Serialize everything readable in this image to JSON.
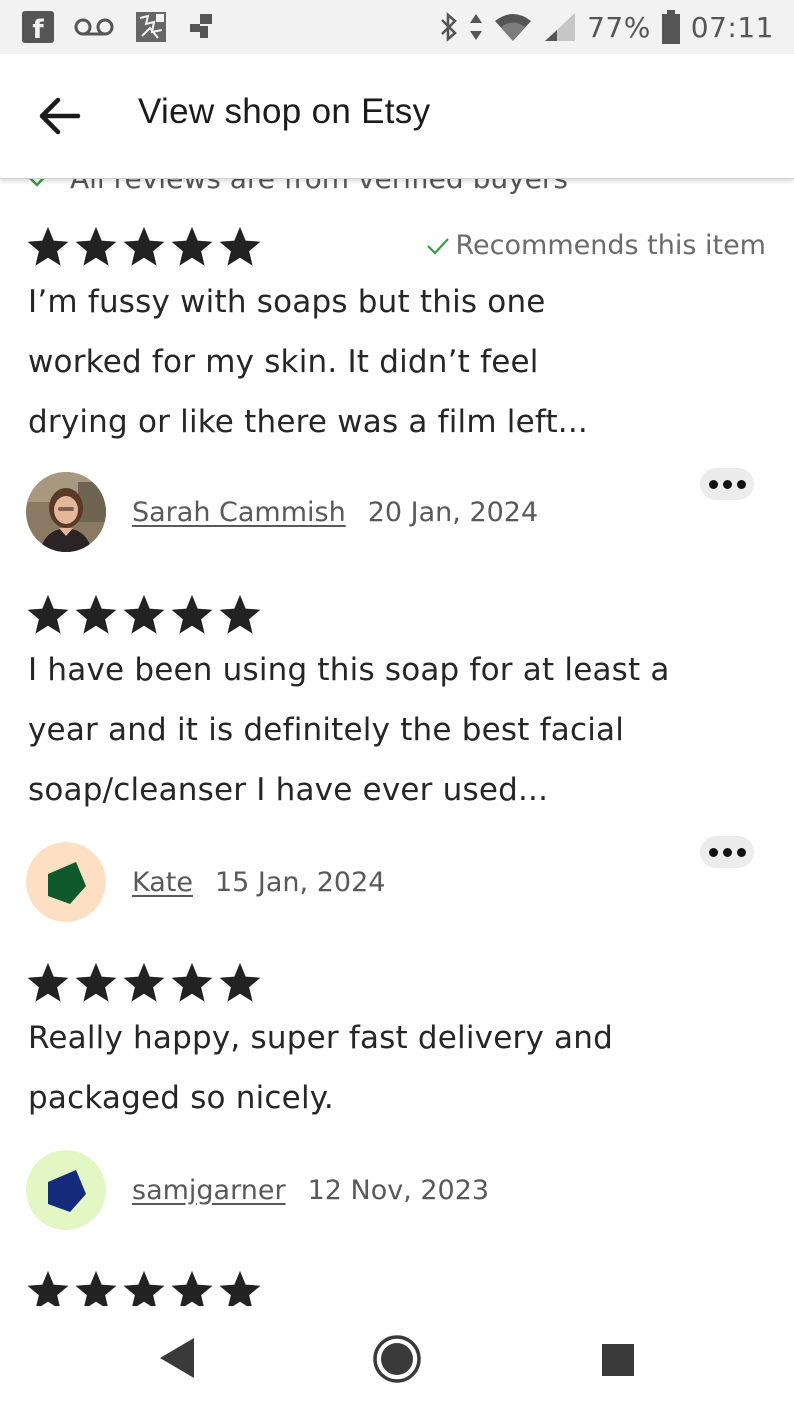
{
  "status_bar": {
    "battery_percent": "77%",
    "time": "07:11",
    "icons_left": [
      "facebook-icon",
      "voicemail-icon",
      "photo-app-icon",
      "app-grid-icon"
    ],
    "icons_right": [
      "bluetooth-icon",
      "data-arrows-icon",
      "wifi-icon",
      "signal-icon",
      "battery-icon"
    ]
  },
  "app_bar": {
    "title": "View shop on Etsy",
    "back_icon": "arrow-left-icon"
  },
  "verified_note": "All reviews are from verified buyers",
  "reviews": [
    {
      "rating": 5,
      "recommends": "Recommends this item",
      "text": "I’m fussy with soaps but this one worked for my skin. It didn’t feel drying or like there was a film left...",
      "reviewer": "Sarah Cammish",
      "date": "20 Jan, 2024",
      "avatar": "photo-avatar"
    },
    {
      "rating": 5,
      "text": "I have been using this soap for at least a year and it is definitely the best facial soap/cleanser I have ever used...",
      "reviewer": "Kate",
      "date": "15 Jan, 2024",
      "avatar": "pentagon-avatar",
      "avatar_bg": "#fde0c3",
      "avatar_fg": "#0e5a2b"
    },
    {
      "rating": 5,
      "text": "Really happy, super fast delivery and packaged so nicely.",
      "reviewer": "samjgarner",
      "date": "12 Nov, 2023",
      "avatar": "pentagon-avatar",
      "avatar_bg": "#e2f7c4",
      "avatar_fg": "#132b7a"
    },
    {
      "rating": 5
    }
  ],
  "colors": {
    "star": "#222222",
    "check_green": "#3a9a4a"
  },
  "nav_bar": {
    "icons": [
      "back-triangle-icon",
      "home-circle-icon",
      "recents-square-icon"
    ]
  }
}
